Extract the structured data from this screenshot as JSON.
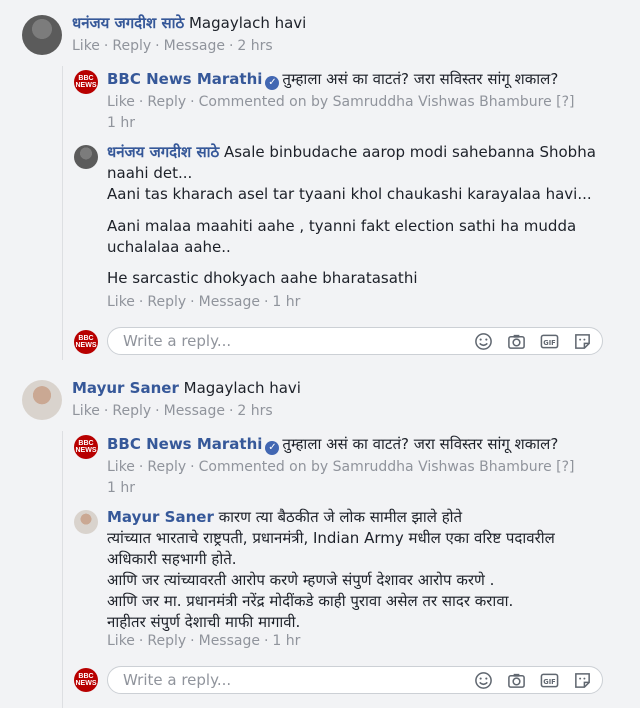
{
  "separator": "·",
  "thread1": {
    "comment": {
      "author": "धनंजय जगदीश साठे",
      "text": "Magaylach havi",
      "actions": [
        "Like",
        "Reply",
        "Message"
      ],
      "time": "2 hrs"
    },
    "reply1": {
      "author": "BBC News Marathi",
      "text": "तुम्हाला असं का वाटतं? जरा सविस्तर सांगू शकाल?",
      "actions": [
        "Like",
        "Reply"
      ],
      "commented_on_by": "Commented on by Samruddha Vishwas Bhambure [?]",
      "time": "1 hr"
    },
    "reply2": {
      "author": "धनंजय जगदीश साठे",
      "lines": [
        "Asale binbudache aarop modi sahebanna Shobha",
        "naahi det...",
        "Aani tas kharach asel tar tyaani khol chaukashi karayalaa havi...",
        "Aani malaa maahiti aahe , tyanni fakt election sathi ha mudda",
        "uchalalaa aahe..",
        "He sarcastic dhokyach aahe bharatasathi"
      ],
      "actions": [
        "Like",
        "Reply",
        "Message"
      ],
      "time": "1 hr"
    },
    "reply_box": {
      "placeholder": "Write a reply..."
    }
  },
  "thread2": {
    "comment": {
      "author": "Mayur Saner",
      "text": "Magaylach havi",
      "actions": [
        "Like",
        "Reply",
        "Message"
      ],
      "time": "2 hrs"
    },
    "reply1": {
      "author": "BBC News Marathi",
      "text": "तुम्हाला असं का वाटतं? जरा सविस्तर सांगू शकाल?",
      "actions": [
        "Like",
        "Reply"
      ],
      "commented_on_by": "Commented on by Samruddha Vishwas Bhambure [?]",
      "time": "1 hr"
    },
    "reply2": {
      "author": "Mayur Saner",
      "lines": [
        "कारण त्या बैठकीत जे लोक सामील झाले होते",
        "त्यांच्यात भारताचे राष्ट्रपती, प्रधानमंत्री, Indian Army मधील एका वरिष्ट पदावरील",
        "अधिकारी सहभागी होते.",
        "आणि जर त्यांच्यावरती आरोप करणे म्हणजे संपुर्ण देशावर आरोप करणे .",
        "आणि जर मा. प्रधानमंत्री नरेंद्र मोदींकडे काही पुरावा असेल तर सादर करावा.",
        "नाहीतर संपुर्ण देशाची माफी मागावी."
      ],
      "actions": [
        "Like",
        "Reply",
        "Message"
      ],
      "time": "1 hr"
    },
    "reply_box": {
      "placeholder": "Write a reply..."
    }
  },
  "avatar_logo_text": "BBC NEWS",
  "icons": [
    "emoji-icon",
    "camera-icon",
    "gif-icon",
    "sticker-icon"
  ],
  "colors": {
    "link": "#365899",
    "meta": "#90949c",
    "bbc_red": "#b80000",
    "verified": "#4267b2"
  }
}
